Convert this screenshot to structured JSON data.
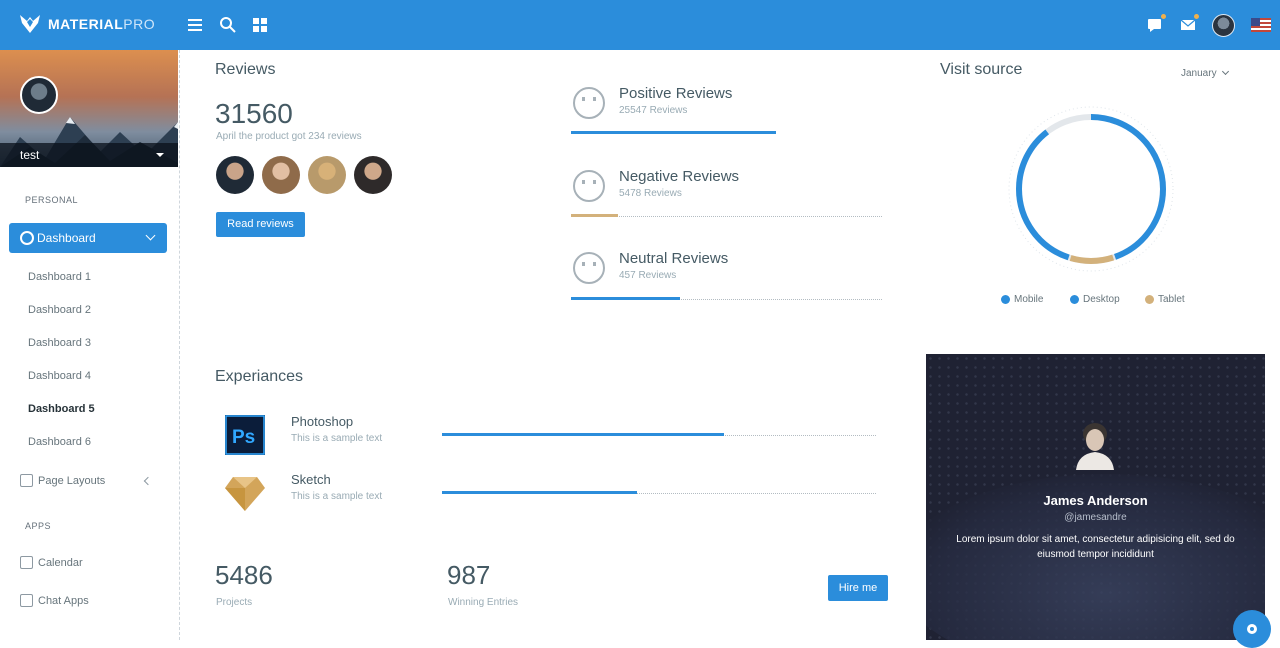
{
  "brand": {
    "name": "MATERIAL",
    "suffix": "PRO"
  },
  "user": {
    "name": "test"
  },
  "colors": {
    "primary": "#2b8ddb",
    "tablet": "#d3b17b",
    "muted": "#99abb4"
  },
  "sidebar": {
    "personal_heading": "PERSONAL",
    "dashboard_label": "Dashboard",
    "sub_items": [
      "Dashboard 1",
      "Dashboard 2",
      "Dashboard 3",
      "Dashboard 4",
      "Dashboard 5",
      "Dashboard 6"
    ],
    "current_sub": "Dashboard 5",
    "page_layouts": "Page Layouts",
    "apps_heading": "APPS",
    "calendar": "Calendar",
    "chat_apps": "Chat Apps"
  },
  "reviews": {
    "title": "Reviews",
    "total": "31560",
    "subtitle": "April the product got 234 reviews",
    "button": "Read reviews",
    "items": [
      {
        "title": "Positive Reviews",
        "count": "25547 Reviews",
        "fraction": 0.66,
        "color": "#2b8ddb"
      },
      {
        "title": "Negative Reviews",
        "count": "5478 Reviews",
        "fraction": 0.15,
        "color": "#d3b17b"
      },
      {
        "title": "Neutral Reviews",
        "count": "457 Reviews",
        "fraction": 0.35,
        "color": "#2b8ddb"
      }
    ]
  },
  "visit_source": {
    "title": "Visit source",
    "month": "January",
    "legend": [
      "Mobile",
      "Desktop",
      "Tablet"
    ]
  },
  "chart_data": {
    "type": "pie",
    "labels": [
      "Mobile",
      "Desktop",
      "Tablet"
    ],
    "values": [
      35,
      45,
      10
    ],
    "remainder": 10,
    "colors": [
      "#2b8ddb",
      "#2b8ddb",
      "#d3b17b"
    ],
    "title": "Visit source"
  },
  "experiences": {
    "title": "Experiances",
    "items": [
      {
        "name": "Photoshop",
        "desc": "This is a sample text",
        "fraction": 0.65
      },
      {
        "name": "Sketch",
        "desc": "This is a sample text",
        "fraction": 0.45
      }
    ]
  },
  "stats": {
    "projects_value": "5486",
    "projects_label": "Projects",
    "entries_value": "987",
    "entries_label": "Winning Entries",
    "hire_button": "Hire me"
  },
  "profile_card": {
    "name": "James Anderson",
    "handle": "@jamesandre",
    "bio": "Lorem ipsum dolor sit amet, consectetur adipisicing elit, sed do eiusmod tempor incididunt"
  }
}
